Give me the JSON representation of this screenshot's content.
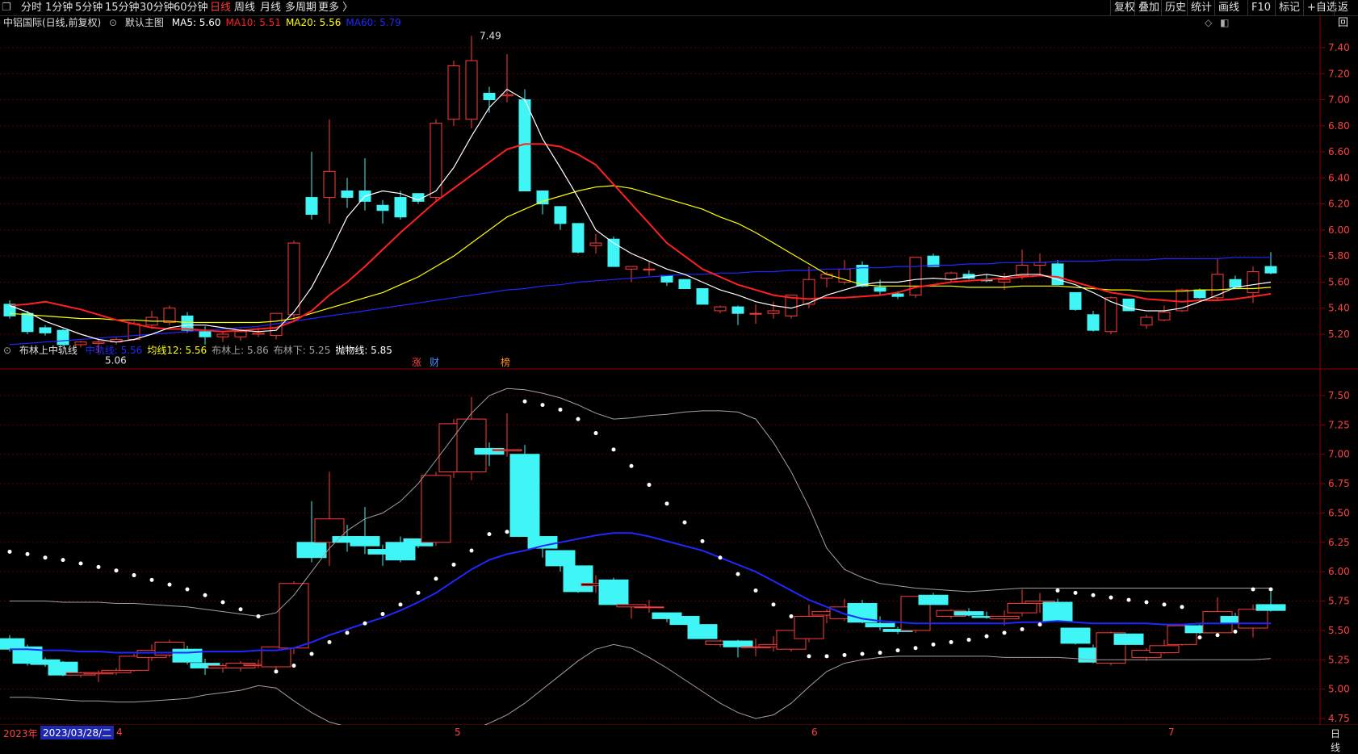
{
  "toolbar": {
    "left_icon": "window-restore-icon",
    "periods": [
      "分时",
      "1分钟",
      "5分钟",
      "15分钟",
      "30分钟",
      "60分钟",
      "日线",
      "周线",
      "月线",
      "多周期",
      "更多 〉"
    ],
    "active_period": "日线",
    "right_buttons": [
      "复权",
      "叠加",
      "历史",
      "统计",
      "画线",
      "F10",
      "标记",
      "+自选",
      "返回"
    ]
  },
  "main_legend": {
    "title": "中铝国际(日线,前复权)",
    "template_label": "默认主图",
    "items": [
      {
        "label": "MA5: 5.60",
        "color": "#ffffff"
      },
      {
        "label": "MA10: 5.51",
        "color": "#ff2020"
      },
      {
        "label": "MA20: 5.56",
        "color": "#ffff00"
      },
      {
        "label": "MA60: 5.79",
        "color": "#1e28ff"
      }
    ],
    "high_marker": "7.49",
    "low_marker": "5.06",
    "event_tags": [
      {
        "text": "涨",
        "color": "#ff4040"
      },
      {
        "text": "财",
        "color": "#4090ff"
      },
      {
        "text": "榜",
        "color": "#ff9020"
      }
    ]
  },
  "sub_legend": {
    "title": "布林上中轨线",
    "items": [
      {
        "label": "中轨线: 5.56",
        "color": "#1e28ff"
      },
      {
        "label": "均线12: 5.56",
        "color": "#ffff00"
      },
      {
        "label": "布林上: 5.86",
        "color": "#a0a0a0"
      },
      {
        "label": "布林下: 5.25",
        "color": "#a0a0a0"
      },
      {
        "label": "抛物线: 5.85",
        "color": "#ffffff"
      }
    ]
  },
  "main_axis": [
    "7.40",
    "7.20",
    "7.00",
    "6.80",
    "6.60",
    "6.40",
    "6.20",
    "6.00",
    "5.80",
    "5.60",
    "5.40",
    "5.20"
  ],
  "sub_axis": [
    "7.50",
    "7.25",
    "7.00",
    "6.75",
    "6.50",
    "6.25",
    "6.00",
    "5.75",
    "5.50",
    "5.25",
    "5.00",
    "4.75"
  ],
  "bottom": {
    "year_label": "2023年",
    "cursor_date": "2023/03/28/二",
    "month_labels": [
      "4",
      "5",
      "6",
      "7"
    ],
    "period_label": "日线"
  },
  "colors": {
    "up": "#ff3b3b",
    "down": "#3ff5f5",
    "ma5": "#ffffff",
    "ma10": "#ff2020",
    "ma20": "#ffff00",
    "ma60": "#1e28ff",
    "grid": "#5a0000"
  },
  "chart_data": {
    "type": "candlestick",
    "title": "中铝国际(日线,前复权)",
    "candles": [
      [
        5.43,
        5.46,
        5.32,
        5.34
      ],
      [
        5.36,
        5.38,
        5.2,
        5.22
      ],
      [
        5.25,
        5.27,
        5.19,
        5.21
      ],
      [
        5.23,
        5.24,
        5.11,
        5.12
      ],
      [
        5.12,
        5.15,
        5.1,
        5.14
      ],
      [
        5.13,
        5.16,
        5.06,
        5.14
      ],
      [
        5.14,
        5.18,
        5.12,
        5.16
      ],
      [
        5.16,
        5.3,
        5.15,
        5.28
      ],
      [
        5.27,
        5.38,
        5.24,
        5.33
      ],
      [
        5.29,
        5.42,
        5.27,
        5.4
      ],
      [
        5.34,
        5.37,
        5.21,
        5.23
      ],
      [
        5.22,
        5.26,
        5.12,
        5.18
      ],
      [
        5.18,
        5.22,
        5.14,
        5.2
      ],
      [
        5.18,
        5.24,
        5.15,
        5.22
      ],
      [
        5.2,
        5.25,
        5.18,
        5.21
      ],
      [
        5.19,
        5.28,
        5.16,
        5.36
      ],
      [
        5.35,
        5.92,
        5.3,
        5.9
      ],
      [
        6.25,
        6.6,
        6.08,
        6.12
      ],
      [
        6.25,
        6.85,
        6.05,
        6.45
      ],
      [
        6.3,
        6.4,
        6.17,
        6.25
      ],
      [
        6.3,
        6.55,
        6.15,
        6.22
      ],
      [
        6.19,
        6.23,
        6.05,
        6.15
      ],
      [
        6.25,
        6.3,
        6.08,
        6.1
      ],
      [
        6.28,
        6.28,
        6.2,
        6.22
      ],
      [
        6.25,
        6.85,
        6.22,
        6.82
      ],
      [
        6.85,
        7.3,
        6.8,
        7.26
      ],
      [
        6.85,
        7.49,
        6.78,
        7.3
      ],
      [
        7.05,
        7.1,
        6.9,
        7.0
      ],
      [
        7.03,
        7.35,
        6.98,
        7.04
      ],
      [
        7.0,
        7.08,
        6.3,
        6.3
      ],
      [
        6.3,
        6.3,
        6.12,
        6.2
      ],
      [
        6.18,
        6.18,
        6.0,
        6.05
      ],
      [
        6.05,
        6.05,
        5.82,
        5.83
      ],
      [
        5.88,
        5.97,
        5.82,
        5.9
      ],
      [
        5.93,
        5.95,
        5.72,
        5.72
      ],
      [
        5.7,
        5.72,
        5.6,
        5.72
      ],
      [
        5.7,
        5.76,
        5.65,
        5.7
      ],
      [
        5.65,
        5.65,
        5.57,
        5.6
      ],
      [
        5.62,
        5.62,
        5.55,
        5.55
      ],
      [
        5.55,
        5.55,
        5.43,
        5.43
      ],
      [
        5.38,
        5.42,
        5.36,
        5.41
      ],
      [
        5.41,
        5.42,
        5.27,
        5.36
      ],
      [
        5.36,
        5.43,
        5.28,
        5.36
      ],
      [
        5.36,
        5.45,
        5.32,
        5.38
      ],
      [
        5.34,
        5.48,
        5.32,
        5.5
      ],
      [
        5.43,
        5.72,
        5.4,
        5.62
      ],
      [
        5.63,
        5.68,
        5.56,
        5.66
      ],
      [
        5.6,
        5.77,
        5.58,
        5.7
      ],
      [
        5.73,
        5.76,
        5.56,
        5.57
      ],
      [
        5.56,
        5.62,
        5.5,
        5.53
      ],
      [
        5.51,
        5.53,
        5.47,
        5.49
      ],
      [
        5.5,
        5.79,
        5.48,
        5.79
      ],
      [
        5.8,
        5.82,
        5.72,
        5.72
      ],
      [
        5.62,
        5.68,
        5.6,
        5.67
      ],
      [
        5.66,
        5.69,
        5.62,
        5.63
      ],
      [
        5.62,
        5.66,
        5.6,
        5.61
      ],
      [
        5.6,
        5.67,
        5.54,
        5.62
      ],
      [
        5.65,
        5.85,
        5.62,
        5.73
      ],
      [
        5.73,
        5.82,
        5.65,
        5.75
      ],
      [
        5.74,
        5.77,
        5.58,
        5.58
      ],
      [
        5.52,
        5.52,
        5.38,
        5.39
      ],
      [
        5.35,
        5.38,
        5.22,
        5.23
      ],
      [
        5.22,
        5.49,
        5.2,
        5.48
      ],
      [
        5.47,
        5.47,
        5.38,
        5.38
      ],
      [
        5.27,
        5.35,
        5.24,
        5.33
      ],
      [
        5.31,
        5.42,
        5.3,
        5.37
      ],
      [
        5.38,
        5.55,
        5.37,
        5.54
      ],
      [
        5.54,
        5.55,
        5.47,
        5.48
      ],
      [
        5.48,
        5.78,
        5.46,
        5.66
      ],
      [
        5.62,
        5.65,
        5.56,
        5.56
      ],
      [
        5.52,
        5.72,
        5.44,
        5.68
      ],
      [
        5.72,
        5.83,
        5.66,
        5.67
      ]
    ],
    "ma5": [
      5.42,
      5.37,
      5.3,
      5.25,
      5.2,
      5.16,
      5.14,
      5.16,
      5.2,
      5.25,
      5.27,
      5.27,
      5.25,
      5.23,
      5.22,
      5.23,
      5.37,
      5.56,
      5.82,
      6.1,
      6.26,
      6.3,
      6.28,
      6.23,
      6.3,
      6.48,
      6.72,
      6.94,
      7.08,
      7.0,
      6.7,
      6.48,
      6.25,
      6.0,
      5.9,
      5.82,
      5.76,
      5.7,
      5.66,
      5.6,
      5.54,
      5.5,
      5.45,
      5.42,
      5.4,
      5.44,
      5.5,
      5.54,
      5.58,
      5.6,
      5.6,
      5.62,
      5.63,
      5.62,
      5.64,
      5.66,
      5.64,
      5.66,
      5.66,
      5.62,
      5.58,
      5.52,
      5.45,
      5.4,
      5.38,
      5.38,
      5.4,
      5.45,
      5.5,
      5.56,
      5.58,
      5.6
    ],
    "ma10": [
      5.42,
      5.43,
      5.45,
      5.42,
      5.39,
      5.35,
      5.31,
      5.28,
      5.25,
      5.24,
      5.24,
      5.23,
      5.22,
      5.23,
      5.24,
      5.25,
      5.3,
      5.38,
      5.5,
      5.6,
      5.72,
      5.85,
      5.98,
      6.1,
      6.22,
      6.32,
      6.42,
      6.52,
      6.62,
      6.66,
      6.66,
      6.64,
      6.58,
      6.5,
      6.35,
      6.2,
      6.05,
      5.9,
      5.8,
      5.7,
      5.64,
      5.58,
      5.54,
      5.5,
      5.48,
      5.47,
      5.48,
      5.48,
      5.49,
      5.5,
      5.52,
      5.56,
      5.58,
      5.6,
      5.61,
      5.62,
      5.63,
      5.64,
      5.65,
      5.64,
      5.6,
      5.56,
      5.52,
      5.5,
      5.47,
      5.46,
      5.45,
      5.46,
      5.46,
      5.47,
      5.49,
      5.51
    ],
    "ma20": [
      5.36,
      5.35,
      5.34,
      5.33,
      5.32,
      5.32,
      5.31,
      5.31,
      5.3,
      5.3,
      5.29,
      5.29,
      5.29,
      5.29,
      5.29,
      5.3,
      5.32,
      5.36,
      5.4,
      5.44,
      5.48,
      5.52,
      5.58,
      5.64,
      5.72,
      5.8,
      5.9,
      6.0,
      6.1,
      6.16,
      6.22,
      6.26,
      6.3,
      6.33,
      6.34,
      6.32,
      6.28,
      6.24,
      6.2,
      6.16,
      6.1,
      6.05,
      5.98,
      5.9,
      5.82,
      5.74,
      5.66,
      5.62,
      5.58,
      5.57,
      5.57,
      5.57,
      5.57,
      5.57,
      5.56,
      5.56,
      5.56,
      5.57,
      5.57,
      5.57,
      5.56,
      5.55,
      5.54,
      5.54,
      5.53,
      5.53,
      5.53,
      5.54,
      5.54,
      5.55,
      5.55,
      5.56
    ],
    "ma60": [
      5.12,
      5.13,
      5.14,
      5.15,
      5.16,
      5.17,
      5.18,
      5.19,
      5.2,
      5.21,
      5.22,
      5.23,
      5.24,
      5.25,
      5.26,
      5.28,
      5.3,
      5.32,
      5.34,
      5.36,
      5.38,
      5.4,
      5.42,
      5.44,
      5.46,
      5.48,
      5.5,
      5.52,
      5.54,
      5.55,
      5.57,
      5.58,
      5.6,
      5.61,
      5.62,
      5.63,
      5.64,
      5.65,
      5.66,
      5.66,
      5.67,
      5.67,
      5.68,
      5.68,
      5.69,
      5.69,
      5.7,
      5.7,
      5.71,
      5.71,
      5.72,
      5.72,
      5.73,
      5.73,
      5.74,
      5.74,
      5.75,
      5.75,
      5.75,
      5.76,
      5.76,
      5.76,
      5.77,
      5.77,
      5.77,
      5.78,
      5.78,
      5.78,
      5.78,
      5.79,
      5.79,
      5.79
    ],
    "boll_mid": [
      5.34,
      5.34,
      5.33,
      5.33,
      5.32,
      5.32,
      5.31,
      5.31,
      5.31,
      5.31,
      5.31,
      5.32,
      5.32,
      5.32,
      5.33,
      5.33,
      5.35,
      5.4,
      5.46,
      5.51,
      5.56,
      5.61,
      5.67,
      5.74,
      5.82,
      5.92,
      6.02,
      6.1,
      6.15,
      6.18,
      6.22,
      6.25,
      6.28,
      6.31,
      6.33,
      6.33,
      6.3,
      6.26,
      6.22,
      6.18,
      6.12,
      6.06,
      6.0,
      5.92,
      5.84,
      5.76,
      5.7,
      5.64,
      5.6,
      5.58,
      5.57,
      5.56,
      5.56,
      5.56,
      5.56,
      5.56,
      5.56,
      5.57,
      5.57,
      5.58,
      5.57,
      5.56,
      5.56,
      5.56,
      5.56,
      5.55,
      5.55,
      5.56,
      5.56,
      5.56,
      5.56,
      5.56
    ],
    "boll_up": [
      5.75,
      5.75,
      5.75,
      5.74,
      5.74,
      5.74,
      5.73,
      5.73,
      5.72,
      5.71,
      5.7,
      5.68,
      5.66,
      5.64,
      5.62,
      5.65,
      5.8,
      6.0,
      6.2,
      6.35,
      6.45,
      6.5,
      6.6,
      6.75,
      6.95,
      7.15,
      7.35,
      7.5,
      7.56,
      7.55,
      7.52,
      7.48,
      7.42,
      7.35,
      7.3,
      7.31,
      7.33,
      7.34,
      7.36,
      7.37,
      7.37,
      7.36,
      7.3,
      7.1,
      6.85,
      6.55,
      6.2,
      6.02,
      5.95,
      5.9,
      5.88,
      5.86,
      5.85,
      5.84,
      5.83,
      5.84,
      5.85,
      5.86,
      5.86,
      5.86,
      5.86,
      5.86,
      5.86,
      5.86,
      5.86,
      5.86,
      5.86,
      5.86,
      5.86,
      5.86,
      5.86,
      5.86
    ],
    "boll_dn": [
      4.93,
      4.93,
      4.92,
      4.91,
      4.9,
      4.9,
      4.89,
      4.89,
      4.9,
      4.91,
      4.92,
      4.95,
      4.97,
      4.99,
      5.03,
      5.01,
      4.9,
      4.8,
      4.72,
      4.68,
      4.67,
      4.65,
      4.63,
      4.62,
      4.61,
      4.62,
      4.65,
      4.71,
      4.78,
      4.88,
      5.0,
      5.12,
      5.24,
      5.34,
      5.38,
      5.35,
      5.27,
      5.18,
      5.08,
      4.98,
      4.88,
      4.8,
      4.75,
      4.78,
      4.88,
      5.02,
      5.15,
      5.22,
      5.25,
      5.27,
      5.28,
      5.28,
      5.28,
      5.28,
      5.28,
      5.28,
      5.27,
      5.27,
      5.27,
      5.27,
      5.26,
      5.25,
      5.25,
      5.25,
      5.25,
      5.25,
      5.25,
      5.25,
      5.25,
      5.25,
      5.25,
      5.26
    ],
    "sar": [
      6.17,
      6.15,
      6.12,
      6.1,
      6.07,
      6.04,
      6.01,
      5.97,
      5.93,
      5.89,
      5.85,
      5.8,
      5.74,
      5.68,
      5.62,
      5.15,
      5.2,
      5.3,
      5.4,
      5.48,
      5.56,
      5.64,
      5.72,
      5.82,
      5.94,
      6.06,
      6.18,
      6.32,
      6.34,
      7.45,
      7.42,
      7.38,
      7.3,
      7.18,
      7.04,
      6.9,
      6.74,
      6.58,
      6.42,
      6.26,
      6.12,
      5.98,
      5.84,
      5.72,
      5.62,
      5.28,
      5.28,
      5.29,
      5.3,
      5.31,
      5.33,
      5.35,
      5.38,
      5.4,
      5.42,
      5.45,
      5.48,
      5.51,
      5.55,
      5.84,
      5.82,
      5.8,
      5.78,
      5.76,
      5.74,
      5.72,
      5.7,
      5.44,
      5.46,
      5.49,
      5.85,
      5.85
    ]
  }
}
